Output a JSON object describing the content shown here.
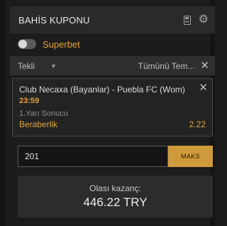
{
  "header": {
    "title": "BAHİS KUPONU",
    "icons": [
      "calculator-icon",
      "gear-icon"
    ]
  },
  "superbet": {
    "label": "Superbet",
    "enabled": false
  },
  "tabbar": {
    "mode": "Tekli",
    "clear_label": "Tümünü Tem..."
  },
  "bet": {
    "match": "Club Necaxa (Bayanlar) - Puebla FC (Wom)",
    "time": "23:59",
    "market": "1.Yarı Sonucu",
    "selection": "Beraberlik",
    "odds": "2.22"
  },
  "stake": {
    "value": "201",
    "max_label": "MAKS"
  },
  "winnings": {
    "label": "Olası kazanç:",
    "amount": "446.22 TRY"
  },
  "colors": {
    "accent": "#e3a53a",
    "button": "#cf9a3b",
    "background": "#1c1c1c"
  }
}
